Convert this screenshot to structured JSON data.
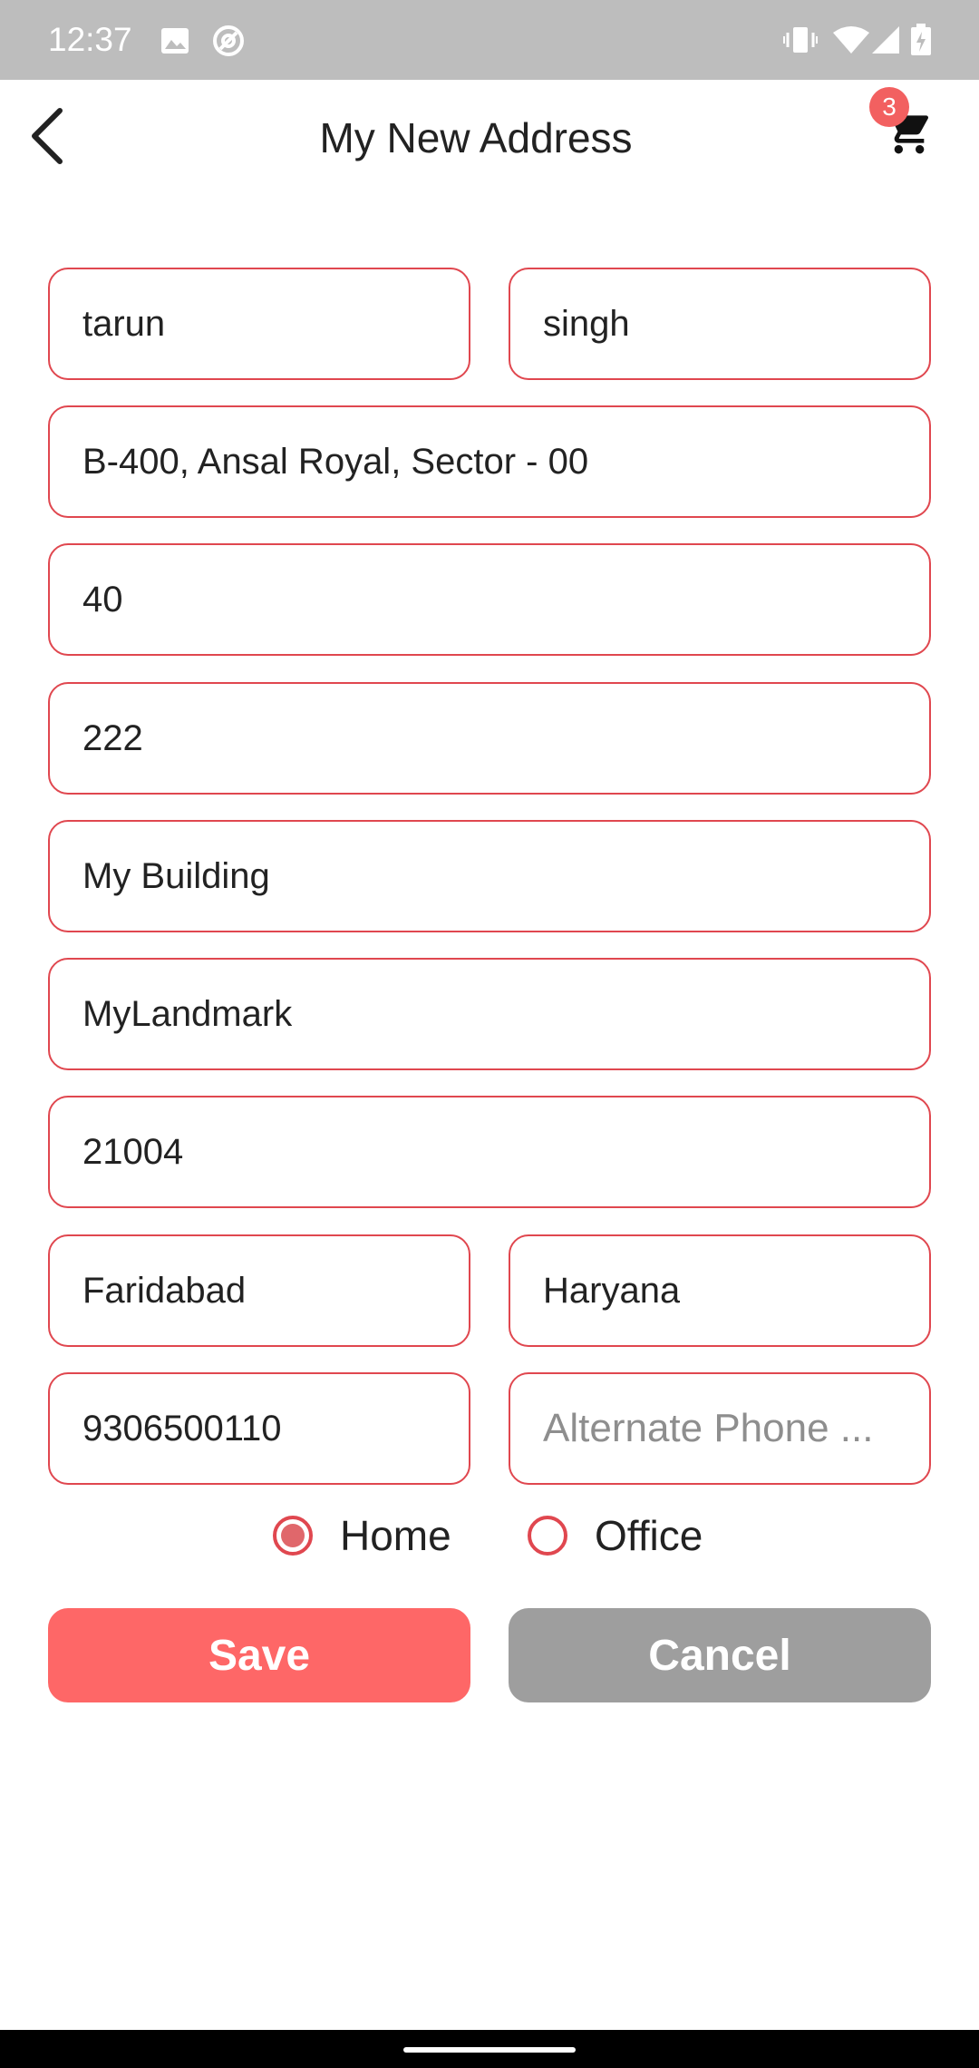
{
  "status_bar": {
    "time": "12:37",
    "icons_left": [
      "image-icon",
      "at-sign-icon"
    ],
    "icons_right": [
      "vibrate-icon",
      "wifi-icon",
      "signal-icon",
      "battery-charging-icon"
    ]
  },
  "header": {
    "title": "My New Address",
    "back_icon": "chevron-left-icon",
    "cart_icon": "cart-icon",
    "cart_count": "3"
  },
  "form": {
    "first_name": "tarun",
    "last_name": "singh",
    "address": "B-400, Ansal Royal, Sector - 00",
    "field_4": "40",
    "field_5": "222",
    "building": "My Building",
    "landmark": "MyLandmark",
    "pincode": "21004",
    "city": "Faridabad",
    "state": "Haryana",
    "phone": "9306500110",
    "alternate_phone_placeholder": "Alternate Phone ..."
  },
  "address_type": {
    "options": [
      "Home",
      "Office"
    ],
    "selected": "Home"
  },
  "actions": {
    "save_label": "Save",
    "cancel_label": "Cancel"
  },
  "colors": {
    "accent": "#e0474f",
    "save_button": "#fe6767",
    "cancel_button": "#9e9e9e",
    "status_bar": "#bdbdbd"
  }
}
